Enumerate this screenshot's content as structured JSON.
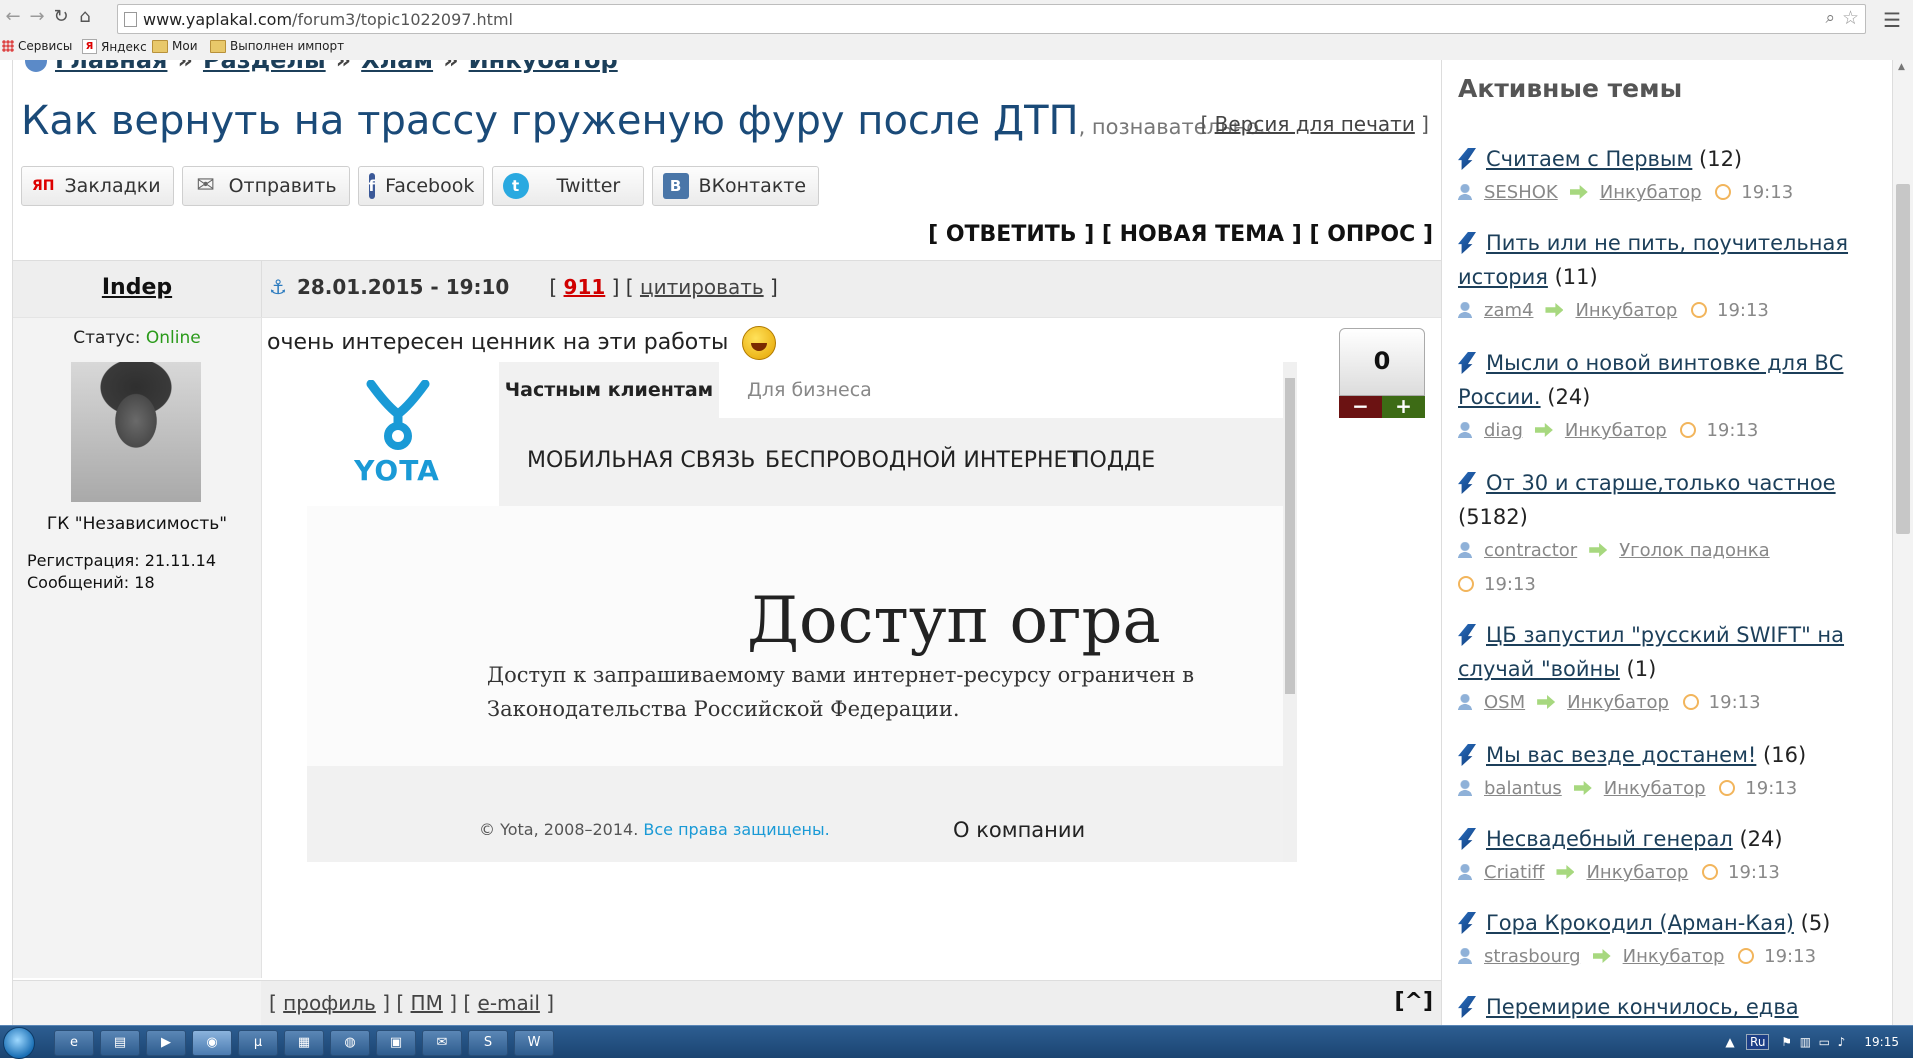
{
  "browser": {
    "url_host": "www.yaplakal.com",
    "url_path": "/forum3/topic1022097.html",
    "bookmarks": [
      "Сервисы",
      "Яндекс",
      "Мои",
      "Выполнен импорт"
    ]
  },
  "breadcrumbs": [
    "Главная",
    "Разделы",
    "Хлам",
    "Инкубатор"
  ],
  "topic": {
    "title": "Как вернуть на трассу груженую фуру после ДТП",
    "subtitle": ", познавательно..",
    "print_label": "Версия для печати"
  },
  "share": [
    {
      "label": "Закладки",
      "icon": "yandex-bookmarks-icon",
      "icon_text": "ЯП",
      "color": "#ffffff"
    },
    {
      "label": "Отправить",
      "icon": "envelope-icon",
      "icon_text": "✉",
      "color": "#ffffff"
    },
    {
      "label": "Facebook",
      "icon": "facebook-icon",
      "icon_text": "f",
      "color": "#3b5998"
    },
    {
      "label": "Twitter",
      "icon": "twitter-icon",
      "icon_text": "t",
      "color": "#2aa9e0"
    },
    {
      "label": "ВКонтакте",
      "icon": "vk-icon",
      "icon_text": "В",
      "color": "#4a76a8"
    }
  ],
  "actions": {
    "reply": "ОТВЕТИТЬ",
    "new_topic": "НОВАЯ ТЕМА",
    "poll": "ОПРОС"
  },
  "post": {
    "author": "Indep",
    "date": "28.01.2015 - 19:10",
    "number": "911",
    "quote_label": "цитировать",
    "status_label": "Статус:",
    "status_value": "Online",
    "group": "ГК \"Независимость\"",
    "registration": "Регистрация: 21.11.14",
    "messages": "Сообщений: 18",
    "text": "очень интересен ценник на эти работы",
    "rating": "0",
    "vote_minus": "−",
    "vote_plus": "+",
    "footer_links": [
      "профиль",
      "ПМ",
      "e-mail"
    ],
    "up_label": "[^]"
  },
  "embedded_screenshot": {
    "logo": "YOTA",
    "tab_active": "Частным клиентам",
    "tab_other": "Для бизнеса",
    "menu": [
      "МОБИЛЬНАЯ СВЯЗЬ",
      "БЕСПРОВОДНОЙ ИНТЕРНЕТ",
      "ПОДДЕ"
    ],
    "heading": "Доступ огра",
    "paragraph_line1": "Доступ к запрашиваемому вами интернет-ресурсу ограничен в",
    "paragraph_line2": "Законодательства Российской Федерации.",
    "copyright": "© Yota, 2008–2014. ",
    "rights": "Все права защищены.",
    "about": "О компании"
  },
  "sidebar": {
    "title": "Активные темы",
    "topics": [
      {
        "title": "Считаем с Первым",
        "count": "(12)",
        "user": "SESHOK",
        "section": "Инкубатор",
        "time": "19:13"
      },
      {
        "title": "Пить или не пить, поучительная история",
        "count": "(11)",
        "user": "zam4",
        "section": "Инкубатор",
        "time": "19:13"
      },
      {
        "title": "Мысли о новой винтовке для ВС России.",
        "count": "(24)",
        "user": "diag",
        "section": "Инкубатор",
        "time": "19:13"
      },
      {
        "title": "От 30 и старше,только частное",
        "count": "(5182)",
        "user": "contractor",
        "section": "Уголок падонка",
        "time": "19:13"
      },
      {
        "title": "ЦБ запустил \"русский SWIFT\" на случай \"войны",
        "count": "(1)",
        "user": "OSM",
        "section": "Инкубатор",
        "time": "19:13"
      },
      {
        "title": "Мы вас везде достанем!",
        "count": "(16)",
        "user": "balantus",
        "section": "Инкубатор",
        "time": "19:13"
      },
      {
        "title": "Несвадебный генерал",
        "count": "(24)",
        "user": "Criatiff",
        "section": "Инкубатор",
        "time": "19:13"
      },
      {
        "title": "Гора Крокодил (Арман-Кая)",
        "count": "(5)",
        "user": "strasbourg",
        "section": "Инкубатор",
        "time": "19:13"
      },
      {
        "title": "Перемирие кончилось, едва",
        "count": "",
        "user": "",
        "section": "",
        "time": ""
      }
    ]
  },
  "taskbar": {
    "lang": "Ru",
    "clock": "19:15",
    "apps": [
      "internet-explorer-icon",
      "explorer-icon",
      "media-icon",
      "chrome-icon",
      "utorrent-icon",
      "app-icon",
      "globe-icon",
      "app-icon",
      "mail-icon",
      "skype-icon",
      "word-icon"
    ]
  },
  "colors": {
    "link": "#1c3f5a",
    "title": "#1a4a78",
    "online": "#2a9a1a",
    "post_number": "#d00000",
    "yota": "#1a9ad6"
  }
}
